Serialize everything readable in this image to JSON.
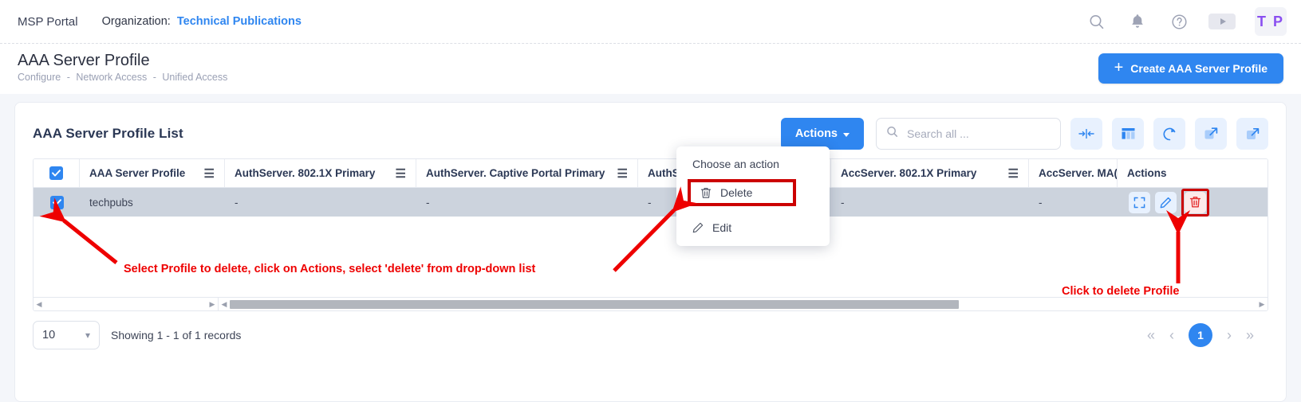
{
  "topbar": {
    "app_name": "MSP Portal",
    "org_label": "Organization:",
    "org_value": "Technical Publications",
    "icons": [
      "search-icon",
      "bell-icon",
      "help-icon",
      "video-icon"
    ],
    "avatar_initials": "T P"
  },
  "page": {
    "title": "AAA Server Profile",
    "breadcrumb": [
      "Configure",
      "Network Access",
      "Unified Access"
    ],
    "breadcrumb_sep": "-",
    "create_button": "Create AAA Server Profile",
    "create_button_icon": "plus-icon"
  },
  "card": {
    "title": "AAA Server Profile List",
    "actions_button": "Actions",
    "search_placeholder": "Search all ...",
    "search_value": "",
    "toolbar_icons": [
      "fit-columns-icon",
      "column-settings-icon",
      "refresh-icon",
      "expand-icon",
      "upload-icon"
    ]
  },
  "table": {
    "columns": [
      "AAA Server Profile",
      "AuthServer. 802.1X Primary",
      "AuthServer. Captive Portal Primary",
      "AuthServer",
      "AccServer. 802.1X Primary",
      "AccServer. MA(",
      "Actions"
    ],
    "rows": [
      {
        "selected": true,
        "cells": [
          "techpubs",
          "-",
          "-",
          "-",
          "-",
          "-"
        ],
        "actions": [
          "fullscreen-icon",
          "edit-icon",
          "delete-icon"
        ]
      }
    ],
    "header_selected": true,
    "row_menu_icon": "hamburger-icon"
  },
  "dropdown": {
    "title": "Choose an action",
    "items": [
      {
        "label": "Delete",
        "icon": "trash-icon",
        "highlighted": true
      },
      {
        "label": "Edit",
        "icon": "pencil-icon",
        "highlighted": false
      }
    ]
  },
  "footer": {
    "page_size": "10",
    "showing": "Showing 1 - 1 of 1 records",
    "pager": {
      "first": "«",
      "prev": "‹",
      "current": "1",
      "next": "›",
      "last": "»"
    }
  },
  "annotations": [
    "Select Profile to delete, click on Actions, select 'delete' from drop-down list",
    "Click to delete Profile"
  ],
  "colors": {
    "accent_blue": "#2f86f0",
    "annotation_red": "#ee0000",
    "row_selected_bg": "#ccd3dd",
    "icon_tile_bg": "#e8f1fe"
  }
}
